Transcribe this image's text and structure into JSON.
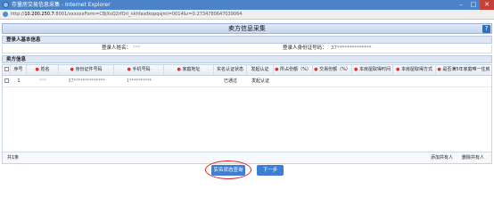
{
  "window": {
    "title": "存量房交易信息采集 - Internet Explorer",
    "controls": {
      "minimize": "–",
      "maximize": "□",
      "close": "✕"
    }
  },
  "address": {
    "host": "10.200.250.7",
    "path": ":8001/xxxxxxForm=CBjXsQ2rfOrl_nkhfasdkopqsjml=0014&r=0.2734780647039064"
  },
  "page": {
    "title": "卖方信息采集",
    "help": "?"
  },
  "login_section": {
    "label": "登录人基本信息",
    "name_label": "登录人姓名：",
    "name_value": "***",
    "id_label": "登录人身份证号码：",
    "id_value": "37**************"
  },
  "seller_section": {
    "label": "卖方信息"
  },
  "table": {
    "headers": [
      "序号",
      "姓名",
      "身份证件号码",
      "手机号码",
      "家庭地址",
      "实名认证状态",
      "发起认证",
      "所占份额（%）",
      "交易份额（%）",
      "本房屋取得时间",
      "本房屋取得方式",
      "是否满5年家庭唯一住房"
    ],
    "required": [
      false,
      true,
      true,
      true,
      true,
      false,
      false,
      true,
      true,
      true,
      true,
      true
    ],
    "rows": [
      {
        "index": "1",
        "name": "***",
        "id_no": "37**************",
        "phone": "1**********",
        "address": "",
        "status": "已通过",
        "action": "发起认证"
      }
    ]
  },
  "footer": {
    "count": "共1条",
    "add_owner": "添加共有人",
    "delete_owner": "删除共有人"
  },
  "buttons": {
    "query_status": "实名状态查询",
    "next": "下一步"
  }
}
